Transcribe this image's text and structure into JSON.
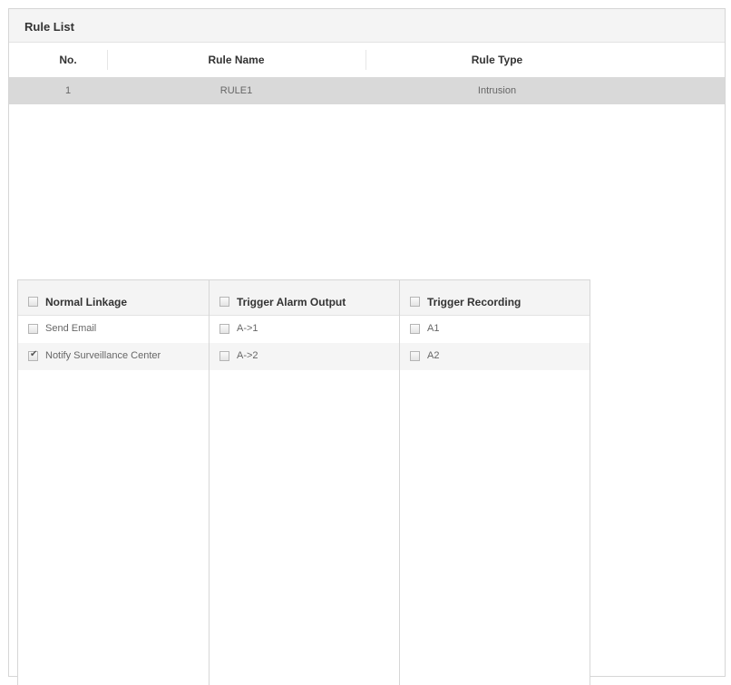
{
  "rule_list": {
    "title": "Rule List",
    "columns": [
      "No.",
      "Rule Name",
      "Rule Type"
    ],
    "rows": [
      {
        "no": "1",
        "name": "RULE1",
        "type": "Intrusion"
      }
    ]
  },
  "linkage": {
    "normal": {
      "header": "Normal Linkage",
      "header_checked": false,
      "items": [
        {
          "label": "Send Email",
          "checked": false
        },
        {
          "label": "Notify Surveillance Center",
          "checked": true
        }
      ]
    },
    "alarm_output": {
      "header": "Trigger Alarm Output",
      "header_checked": false,
      "items": [
        {
          "label": "A->1",
          "checked": false
        },
        {
          "label": "A->2",
          "checked": false
        }
      ]
    },
    "recording": {
      "header": "Trigger Recording",
      "header_checked": false,
      "items": [
        {
          "label": "A1",
          "checked": false
        },
        {
          "label": "A2",
          "checked": false
        }
      ]
    }
  },
  "colors": {
    "header_bg": "#f4f4f4",
    "selected_row_bg": "#d9d9d9",
    "border": "#d6d6d6"
  }
}
